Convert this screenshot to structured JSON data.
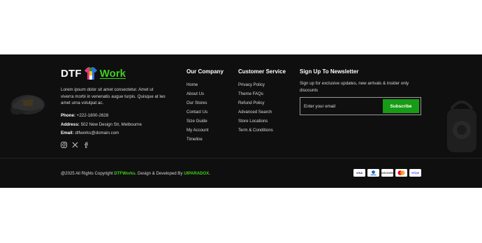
{
  "brand": {
    "name_part1": "DTF",
    "name_part2": "Work"
  },
  "about": {
    "text": "Lorem ipsum dolor sit amet consectetur. Amet ut viverra morbi in venenatis augue turpis. Quisque at leo amet urna volutpat ac."
  },
  "contact": {
    "phone_label": "Phone:",
    "phone": "+222-1800-2628",
    "address_label": "Address:",
    "address": "502 New Design Str, Melbourne",
    "email_label": "Email:",
    "email": "dtfworks@domain.com"
  },
  "social": [
    "instagram-icon",
    "x-icon",
    "facebook-icon"
  ],
  "company": {
    "title": "Our Company",
    "links": [
      "Home",
      "About Us",
      "Our Stores",
      "Contact Us",
      "Size Guide",
      "My Account",
      "Timeline"
    ]
  },
  "service": {
    "title": "Customer Service",
    "links": [
      "Privacy Policy",
      "Theme FAQs",
      "Refund Policy",
      "Advanced Search",
      "Store Locations",
      "Term & Conditions"
    ]
  },
  "newsletter": {
    "title": "Sign Up To Newsletter",
    "description": "Sign up for exclusive updates, new arrivals & insider only discounts",
    "placeholder": "Enter your email",
    "button": "Subscribe"
  },
  "copyright": {
    "prefix": "@2025 All Rights Copyright ",
    "brand": "DTFWorks",
    "middle": ". Design & Developed By ",
    "developer": "UIPARADOX",
    "suffix": "."
  },
  "payments": {
    "visa": "VISA",
    "mastercard": "",
    "discover": "DISCOVER",
    "stripe": "stripe"
  },
  "colors": {
    "background": "#0f0f0f",
    "accent_green": "#3fcf1d",
    "button_green": "#169c15"
  }
}
